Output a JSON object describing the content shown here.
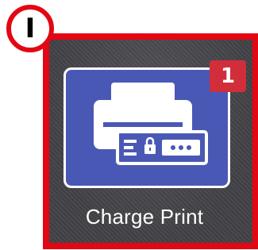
{
  "callout": {
    "label": "I"
  },
  "app_tile": {
    "label": "Charge Print",
    "badge_count": "1",
    "icon": "printer-lock-icon"
  },
  "colors": {
    "frame": "#e30613",
    "tile": "#4a58b5",
    "badge": "#d22d3a",
    "background": "#454549"
  }
}
